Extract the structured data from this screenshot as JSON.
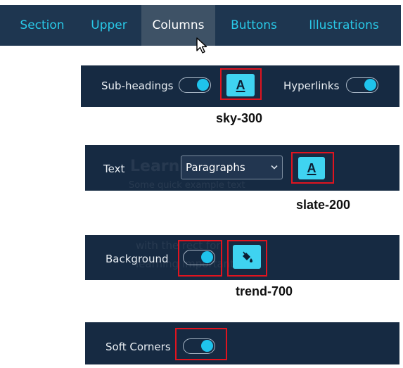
{
  "tabs": [
    {
      "label": "Section"
    },
    {
      "label": "Upper"
    },
    {
      "label": "Columns"
    },
    {
      "label": "Buttons"
    },
    {
      "label": "Illustrations"
    }
  ],
  "active_tab": "Columns",
  "panels": {
    "subheadings": {
      "label": "Sub-headings",
      "toggle_on": true,
      "color_icon": "A"
    },
    "hyperlinks": {
      "label": "Hyperlinks",
      "toggle_on": true
    },
    "text": {
      "label": "Text",
      "select_value": "Paragraphs",
      "color_icon": "A"
    },
    "background": {
      "label": "Background",
      "toggle_on": true
    },
    "soft_corners": {
      "label": "Soft Corners",
      "toggle_on": true
    }
  },
  "captions": {
    "subheadings": "sky-300",
    "text": "slate-200",
    "background": "trend-700"
  },
  "colors": {
    "tab_bar": "#1e3650",
    "tab_active": "#3e5266",
    "accent": "#29c9e8",
    "panel": "#162a42",
    "swatch": "#3fd3f1",
    "highlight": "#e0141f"
  }
}
